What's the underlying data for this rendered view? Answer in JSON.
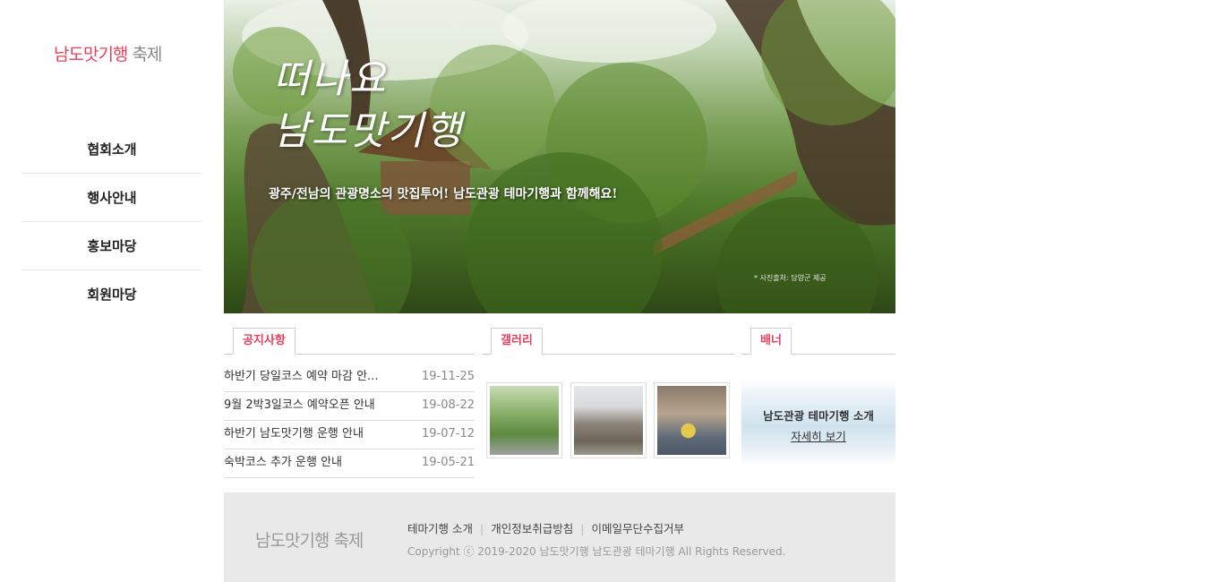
{
  "logo": {
    "main": "남도맛기행",
    "sub": "축제"
  },
  "nav": [
    {
      "label": "협회소개"
    },
    {
      "label": "행사안내"
    },
    {
      "label": "홍보마당"
    },
    {
      "label": "회원마당"
    }
  ],
  "hero": {
    "title_line1": "떠나요",
    "title_line2": "남도맛기행",
    "subtitle": "광주/전남의 관광명소의 맛집투어! 남도관광 테마기행과 함께해요!",
    "credit": "* 사진출처: 담양군 제공"
  },
  "notice": {
    "tab": "공지사항",
    "items": [
      {
        "title": "하반기 당일코스 예약 마감 안...",
        "date": "19-11-25"
      },
      {
        "title": "9월 2박3일코스 예약오픈 안내",
        "date": "19-08-22"
      },
      {
        "title": "하반기 남도맛기행 운행 안내",
        "date": "19-07-12"
      },
      {
        "title": "숙박코스 추가 운행 안내",
        "date": "19-05-21"
      }
    ]
  },
  "gallery": {
    "tab": "갤러리"
  },
  "banner": {
    "tab": "배너",
    "title": "남도관광 테마기행 소개",
    "link": "자세히 보기"
  },
  "footer": {
    "logo": "남도맛기행 축제",
    "links": [
      "테마기행 소개",
      "개인정보취급방침",
      "이메일무단수집거부"
    ],
    "copyright": "Copyright ⓒ 2019-2020 남도맛기행 남도관광 테마기행 All Rights Reserved."
  },
  "colors": {
    "accent": "#e8405e",
    "footer_bg": "#e9e9e9"
  }
}
